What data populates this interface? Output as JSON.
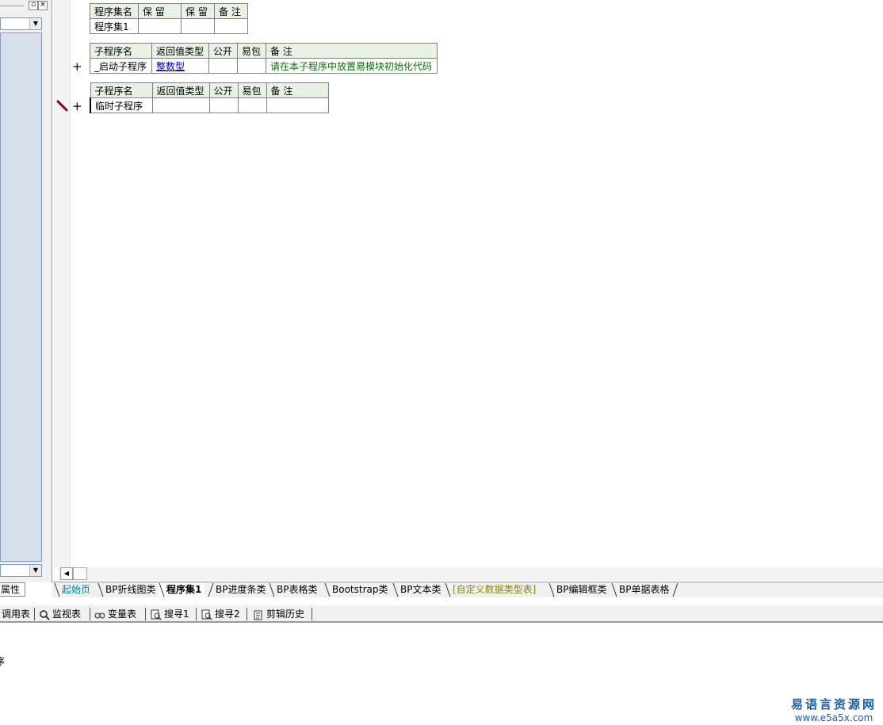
{
  "left_panel": {
    "properties_tab": "属性"
  },
  "program_set_table": {
    "headers": [
      "程序集名",
      "保 留",
      "保 留",
      "备 注"
    ],
    "row": [
      "程序集1",
      "",
      "",
      ""
    ]
  },
  "sub1_table": {
    "headers": [
      "子程序名",
      "返回值类型",
      "公开",
      "易包",
      "备 注"
    ],
    "row": {
      "name": "_启动子程序",
      "return_type": "整数型",
      "public": "",
      "epkg": "",
      "remark": "请在本子程序中放置易模块初始化代码"
    }
  },
  "sub2_table": {
    "headers": [
      "子程序名",
      "返回值类型",
      "公开",
      "易包",
      "备 注"
    ],
    "row": {
      "name": "临时子程序",
      "return_type": "",
      "public": "",
      "epkg": "",
      "remark": ""
    }
  },
  "plus_glyph": "+",
  "doc_tabs": [
    "起始页",
    "BP折线图类",
    "程序集1",
    "BP进度条类",
    "BP表格类",
    "Bootstrap类",
    "BP文本类",
    "[自定义数据类型表]",
    "BP编辑框类",
    "BP单据表格"
  ],
  "bottom_toolbar": [
    {
      "label": "调用表",
      "icon": "call-table-icon"
    },
    {
      "label": "监视表",
      "icon": "magnifier-icon"
    },
    {
      "label": "变量表",
      "icon": "variables-icon"
    },
    {
      "label": "搜寻1",
      "icon": "search-doc-icon"
    },
    {
      "label": "搜寻2",
      "icon": "search-doc-icon"
    },
    {
      "label": "剪辑历史",
      "icon": "clipboard-history-icon"
    }
  ],
  "output_text": "序",
  "watermark": {
    "cn": "易语言资源网",
    "url": "www.e5a5x.com"
  },
  "colors": {
    "header_bg": "#e8f2e4",
    "tree_bg": "#d7dfea",
    "link_blue": "#0000a0",
    "remark_green": "#067006",
    "start_tab": "#00888a",
    "custom_tab": "#888800",
    "watermark": "#1a5ca8"
  }
}
